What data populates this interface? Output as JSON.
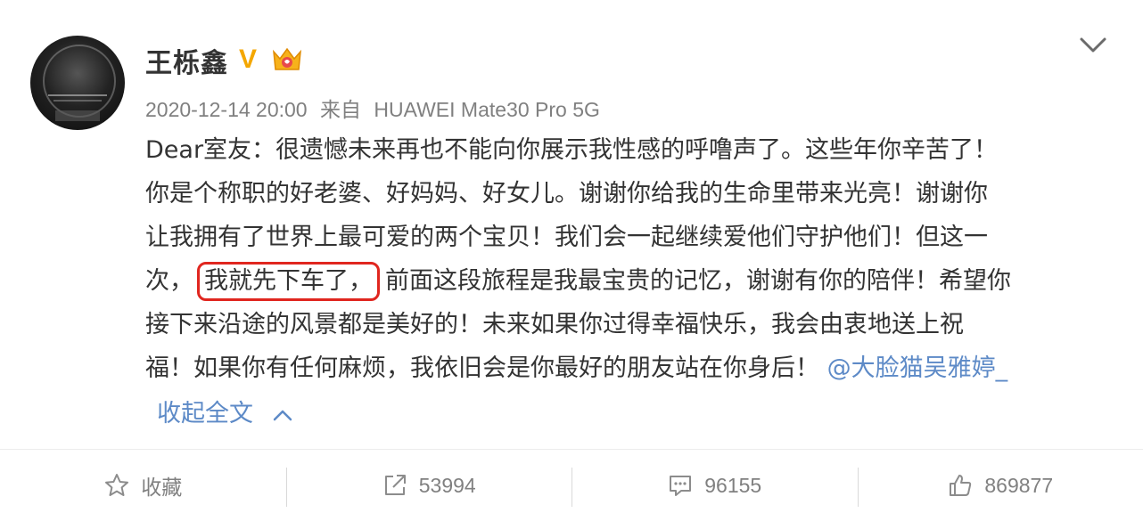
{
  "post": {
    "author": "王栎鑫",
    "verified_badge": "V",
    "timestamp": "2020-12-14 20:00",
    "source_prefix": "来自",
    "source_device": "HUAWEI Mate30 Pro 5G",
    "content": {
      "line1": "Dear室友：很遗憾未来再也不能向你展示我性感的呼噜声了。这些年你辛苦了！",
      "line2": "你是个称职的好老婆、好妈妈、好女儿。谢谢你给我的生命里带来光亮！谢谢你",
      "line3": "让我拥有了世界上最可爱的两个宝贝！我们会一起继续爱他们守护他们！但这一",
      "line4_before": "次，",
      "line4_highlight": "我就先下车了，",
      "line4_after": "前面这段旅程是我最宝贵的记忆，谢谢有你的陪伴！希望你",
      "line5": "接下来沿途的风景都是美好的！未来如果你过得幸福快乐，我会由衷地送上祝",
      "line6": "福！如果你有任何麻烦，我依旧会是你最好的朋友站在你身后！",
      "mention": "@大脸猫吴雅婷_"
    },
    "collapse_label": "收起全文"
  },
  "actions": {
    "favorite_label": "收藏",
    "repost_count": "53994",
    "comment_count": "96155",
    "like_count": "869877"
  },
  "colors": {
    "link": "#5d8ac7",
    "highlight_border": "#e0261f",
    "vip": "#f4a700",
    "muted": "#808080"
  }
}
